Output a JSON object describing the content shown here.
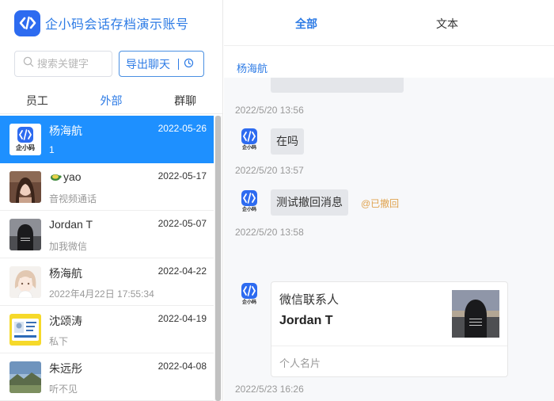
{
  "app": {
    "title": "企小码会话存档演示账号",
    "logo_text": "企小码",
    "brand_color": "#2d6bf0"
  },
  "search": {
    "placeholder": "搜索关键字"
  },
  "toolbar": {
    "export_label": "导出聊天",
    "history_icon": "history-icon"
  },
  "left_tabs": [
    {
      "label": "员工",
      "active": false
    },
    {
      "label": "外部",
      "active": true
    },
    {
      "label": "群聊",
      "active": false
    }
  ],
  "conversations": [
    {
      "name": "杨海航",
      "date": "2022-05-26",
      "sub": "1",
      "active": true,
      "avatar": "qixiaoma-logo"
    },
    {
      "name": "yao",
      "date": "2022-05-17",
      "sub": "音视频通话",
      "active": false,
      "avatar": "girl-photo"
    },
    {
      "name": "Jordan T",
      "date": "2022-05-07",
      "sub": "加我微信",
      "active": false,
      "avatar": "hoodie-photo"
    },
    {
      "name": "杨海航",
      "date": "2022-04-22",
      "sub": "2022年4月22日 17:55:34",
      "active": false,
      "avatar": "anime-avatar"
    },
    {
      "name": "沈颂涛",
      "date": "2022-04-19",
      "sub": "私下",
      "active": false,
      "avatar": "yellow-card"
    },
    {
      "name": "朱远彤",
      "date": "2022-04-08",
      "sub": "听不见",
      "active": false,
      "avatar": "landscape-photo"
    }
  ],
  "right_tabs": [
    {
      "label": "全部",
      "active": true
    },
    {
      "label": "文本",
      "active": false
    }
  ],
  "chat": {
    "contact_name": "杨海航",
    "timestamps": [
      "2022/5/20 13:56",
      "2022/5/20 13:57",
      "2022/5/20 13:58",
      "2022/5/23 16:26"
    ],
    "messages": [
      {
        "text": "在吗"
      },
      {
        "text": "测试撤回消息",
        "status": "@已撤回"
      }
    ],
    "card": {
      "title": "微信联系人",
      "name": "Jordan T",
      "footer": "个人名片"
    }
  },
  "colors": {
    "accent": "#2d7be5",
    "active_row": "#1e90ff",
    "recall": "#e0a34f"
  }
}
